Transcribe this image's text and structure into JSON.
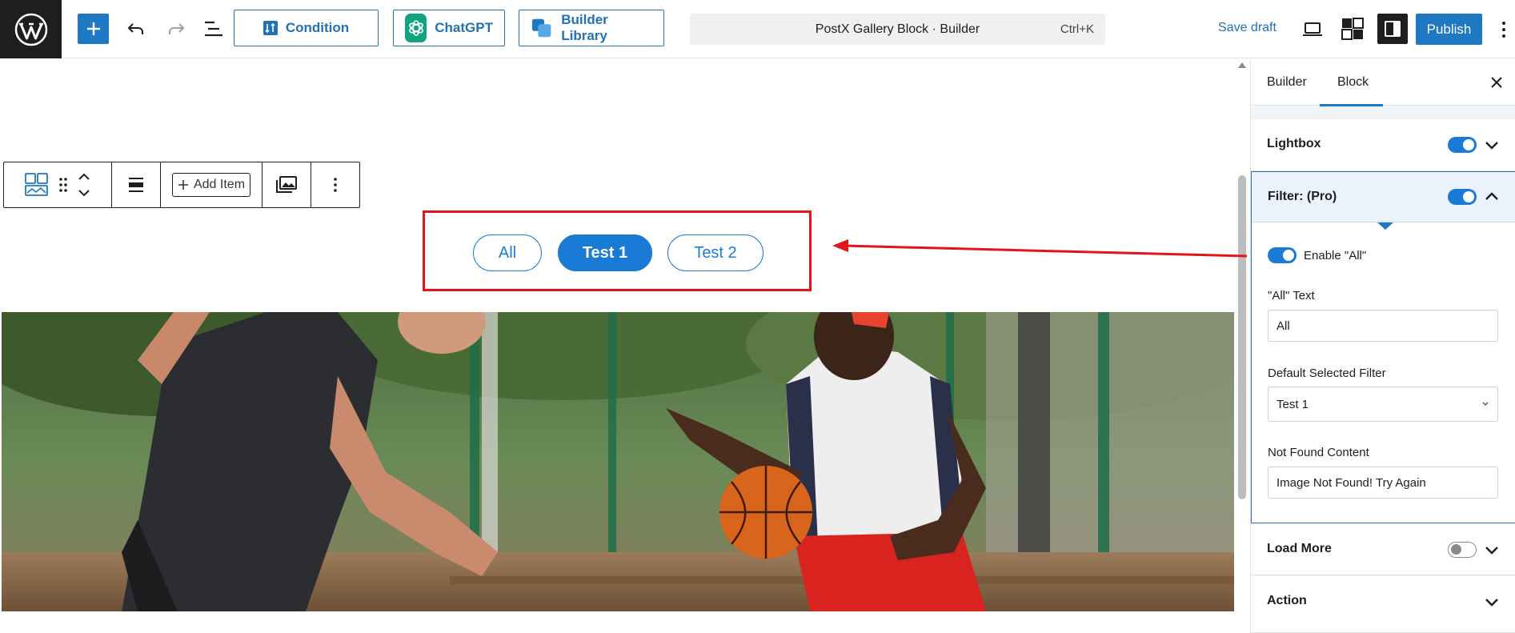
{
  "toolbar": {
    "condition_label": "Condition",
    "chatgpt_label": "ChatGPT",
    "library_label": "Builder Library",
    "doc_title": "PostX Gallery Block · Builder",
    "shortcut": "Ctrl+K",
    "save_draft_label": "Save draft",
    "publish_label": "Publish"
  },
  "block_toolbar": {
    "add_item_label": "Add Item"
  },
  "filters": {
    "items": [
      {
        "label": "All",
        "active": false
      },
      {
        "label": "Test 1",
        "active": true
      },
      {
        "label": "Test 2",
        "active": false
      }
    ]
  },
  "sidebar": {
    "tabs": [
      {
        "label": "Builder"
      },
      {
        "label": "Block",
        "active": true
      }
    ],
    "panels": {
      "lightbox": {
        "title": "Lightbox",
        "enabled": true
      },
      "filter": {
        "title": "Filter: (Pro)",
        "enabled": true,
        "enable_all_label": "Enable \"All\"",
        "all_text_label": "\"All\" Text",
        "all_text_value": "All",
        "default_filter_label": "Default Selected Filter",
        "default_filter_value": "Test 1",
        "not_found_label": "Not Found Content",
        "not_found_value": "Image Not Found! Try Again"
      },
      "load_more": {
        "title": "Load More",
        "enabled": false
      },
      "action": {
        "title": "Action"
      }
    }
  },
  "colors": {
    "accent": "#1e78c2",
    "filter_blue": "#1a7bd6",
    "highlight_red": "#e4141b"
  }
}
